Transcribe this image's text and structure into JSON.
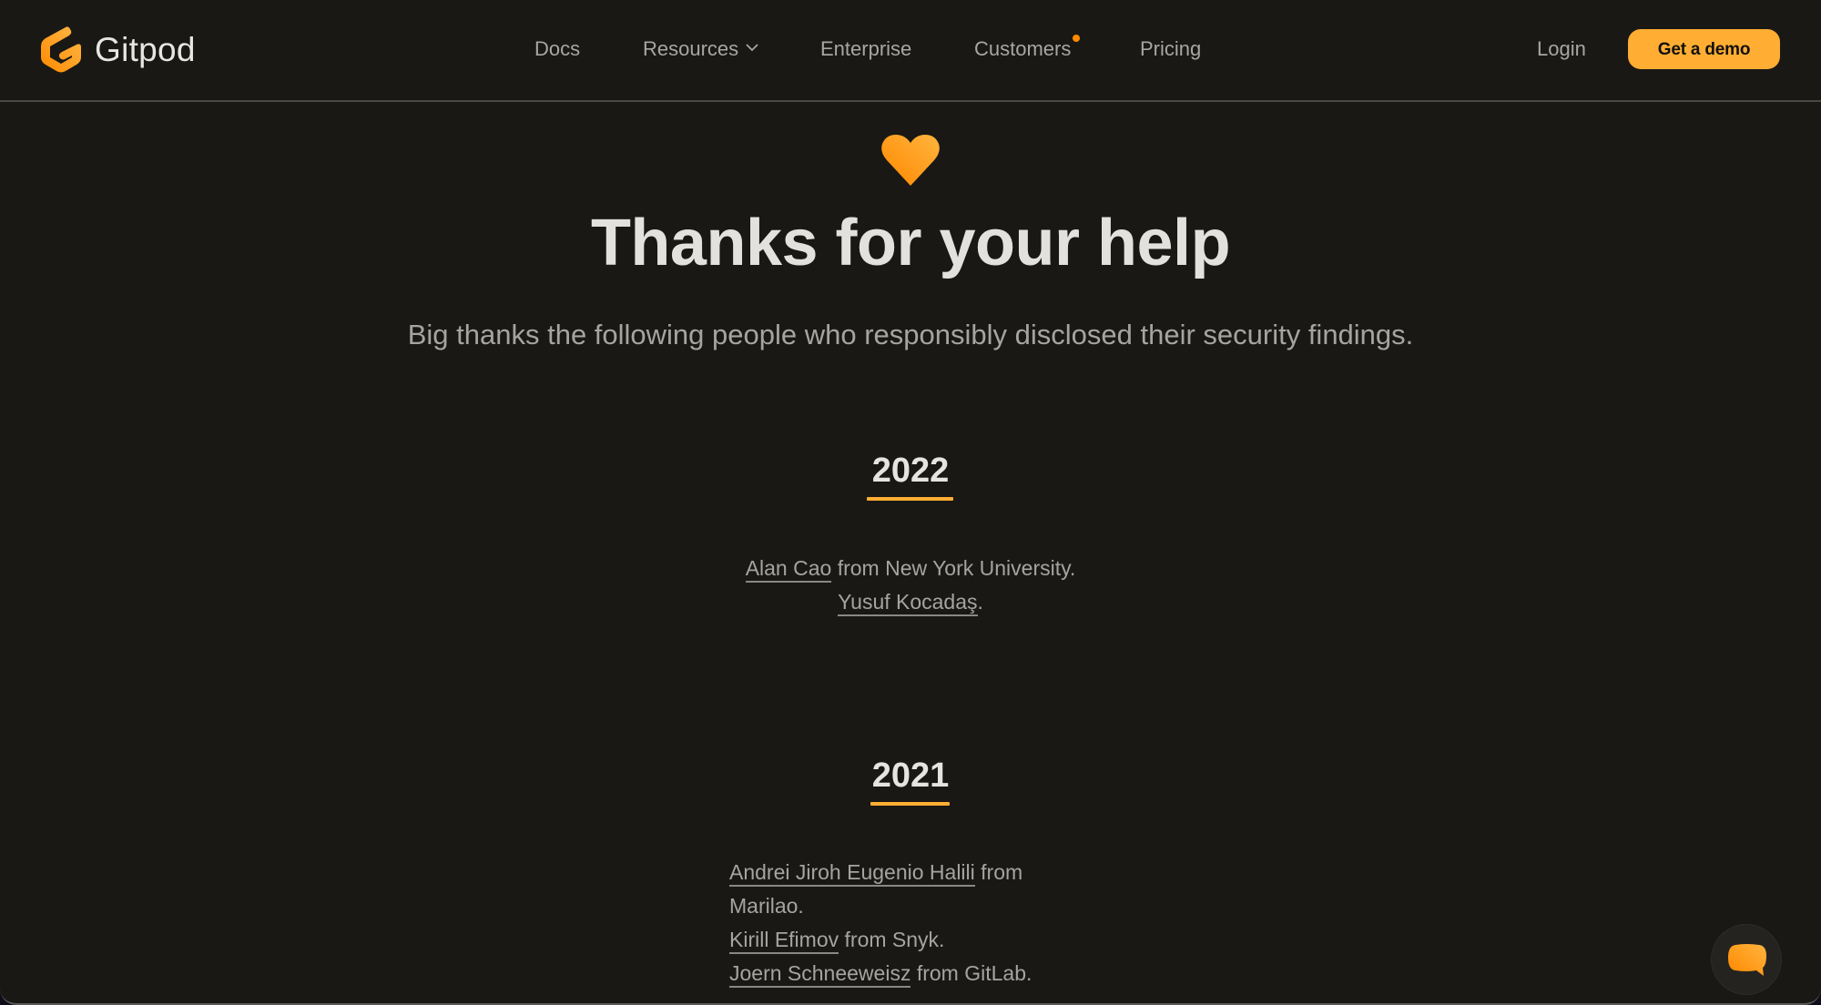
{
  "header": {
    "brand": "Gitpod",
    "nav": [
      {
        "label": "Docs"
      },
      {
        "label": "Resources",
        "has_dropdown": true
      },
      {
        "label": "Enterprise"
      },
      {
        "label": "Customers",
        "has_indicator": true
      },
      {
        "label": "Pricing"
      }
    ],
    "login_label": "Login",
    "demo_label": "Get a demo"
  },
  "colors": {
    "accent": "#ffae33",
    "background": "#191815",
    "indicator": "#ff8a00"
  },
  "main": {
    "icon": "heart-icon",
    "title": "Thanks for your help",
    "subtitle": "Big thanks the following people who responsibly disclosed their security findings.",
    "years": [
      {
        "year": "2022",
        "entries": [
          {
            "name": "Alan Cao",
            "suffix": " from New York University."
          },
          {
            "name": "Yusuf Kocadaş",
            "suffix": "."
          }
        ]
      },
      {
        "year": "2021",
        "entries": [
          {
            "name": "Andrei Jiroh Eugenio Halili",
            "suffix": " from Marilao."
          },
          {
            "name": "Kirill Efimov",
            "suffix": " from Snyk."
          },
          {
            "name": "Joern Schneeweisz",
            "suffix": " from GitLab."
          }
        ]
      }
    ]
  },
  "chat": {
    "icon": "chat-bubble-icon"
  }
}
